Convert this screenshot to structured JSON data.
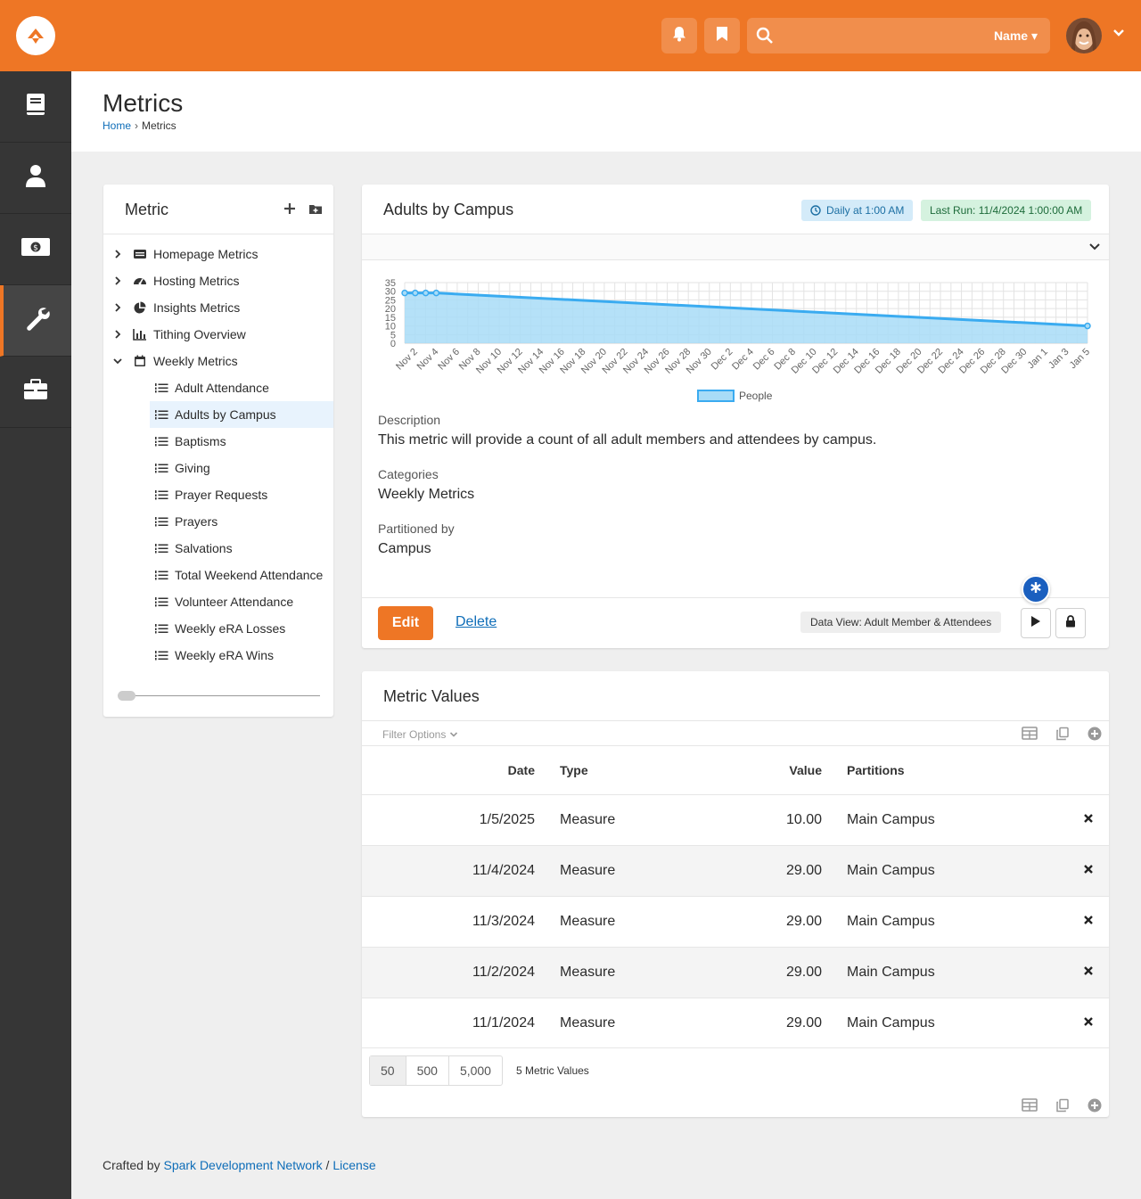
{
  "header": {
    "search_scope": "Name",
    "colors": {
      "brand": "#ee7625",
      "nav": "#363636",
      "link": "#0e6db8",
      "chart_fill": "#a8dcf7",
      "chart_line": "#3aabf0"
    }
  },
  "sidenav": {
    "items": [
      {
        "icon": "book-icon"
      },
      {
        "icon": "user-icon"
      },
      {
        "icon": "money-icon"
      },
      {
        "icon": "wrench-icon",
        "active": true
      },
      {
        "icon": "briefcase-icon"
      }
    ]
  },
  "page": {
    "title": "Metrics",
    "breadcrumb": {
      "home": "Home",
      "sep": "›",
      "current": "Metrics"
    }
  },
  "tree": {
    "title": "Metric",
    "categories": [
      {
        "label": "Homepage Metrics"
      },
      {
        "label": "Hosting Metrics"
      },
      {
        "label": "Insights Metrics"
      },
      {
        "label": "Tithing Overview"
      },
      {
        "label": "Weekly Metrics"
      }
    ],
    "leaves": [
      {
        "label": "Adult Attendance"
      },
      {
        "label": "Adults by Campus",
        "selected": true
      },
      {
        "label": "Baptisms"
      },
      {
        "label": "Giving"
      },
      {
        "label": "Prayer Requests"
      },
      {
        "label": "Prayers"
      },
      {
        "label": "Salvations"
      },
      {
        "label": "Total Weekend Attendance"
      },
      {
        "label": "Volunteer Attendance"
      },
      {
        "label": "Weekly eRA Losses"
      },
      {
        "label": "Weekly eRA Wins"
      }
    ]
  },
  "detail": {
    "title": "Adults by Campus",
    "schedule_badge": "Daily at 1:00 AM",
    "last_run_badge": "Last Run: 11/4/2024 1:00:00 AM",
    "fields": {
      "description_label": "Description",
      "description": "This metric will provide a count of all adult members and attendees by campus.",
      "categories_label": "Categories",
      "categories": "Weekly Metrics",
      "partition_label": "Partitioned by",
      "partition": "Campus"
    },
    "edit_label": "Edit",
    "delete_label": "Delete",
    "dataview_badge": "Data View: Adult Member & Attendees"
  },
  "chart_data": {
    "type": "area",
    "x_tick_labels": [
      "Nov 2",
      "Nov 4",
      "Nov 6",
      "Nov 8",
      "Nov 10",
      "Nov 12",
      "Nov 14",
      "Nov 16",
      "Nov 18",
      "Nov 20",
      "Nov 22",
      "Nov 24",
      "Nov 26",
      "Nov 28",
      "Nov 30",
      "Dec 2",
      "Dec 4",
      "Dec 6",
      "Dec 8",
      "Dec 10",
      "Dec 12",
      "Dec 14",
      "Dec 16",
      "Dec 18",
      "Dec 20",
      "Dec 22",
      "Dec 24",
      "Dec 26",
      "Dec 28",
      "Dec 30",
      "Jan 1",
      "Jan 3",
      "Jan 5"
    ],
    "y_tick_labels": [
      "35",
      "30",
      "25",
      "20",
      "15",
      "10",
      "5",
      "0"
    ],
    "ylim": [
      0,
      35
    ],
    "series": [
      {
        "name": "People",
        "points": [
          {
            "x": "2024-11-01",
            "y": 29
          },
          {
            "x": "2024-11-02",
            "y": 29
          },
          {
            "x": "2024-11-03",
            "y": 29
          },
          {
            "x": "2024-11-04",
            "y": 29
          },
          {
            "x": "2025-01-05",
            "y": 10
          }
        ]
      }
    ],
    "legend": "bottom-center",
    "grid": true
  },
  "values": {
    "title": "Metric Values",
    "filter_label": "Filter Options",
    "columns": {
      "date": "Date",
      "type": "Type",
      "value": "Value",
      "partitions": "Partitions"
    },
    "rows": [
      {
        "date": "1/5/2025",
        "type": "Measure",
        "value": "10.00",
        "partition": "Main Campus"
      },
      {
        "date": "11/4/2024",
        "type": "Measure",
        "value": "29.00",
        "partition": "Main Campus"
      },
      {
        "date": "11/3/2024",
        "type": "Measure",
        "value": "29.00",
        "partition": "Main Campus"
      },
      {
        "date": "11/2/2024",
        "type": "Measure",
        "value": "29.00",
        "partition": "Main Campus"
      },
      {
        "date": "11/1/2024",
        "type": "Measure",
        "value": "29.00",
        "partition": "Main Campus"
      }
    ],
    "page_sizes": [
      "50",
      "500",
      "5,000"
    ],
    "count_text": "5 Metric Values"
  },
  "footer": {
    "prefix": "Crafted by ",
    "org": "Spark Development Network",
    "sep": " / ",
    "license": "License"
  }
}
